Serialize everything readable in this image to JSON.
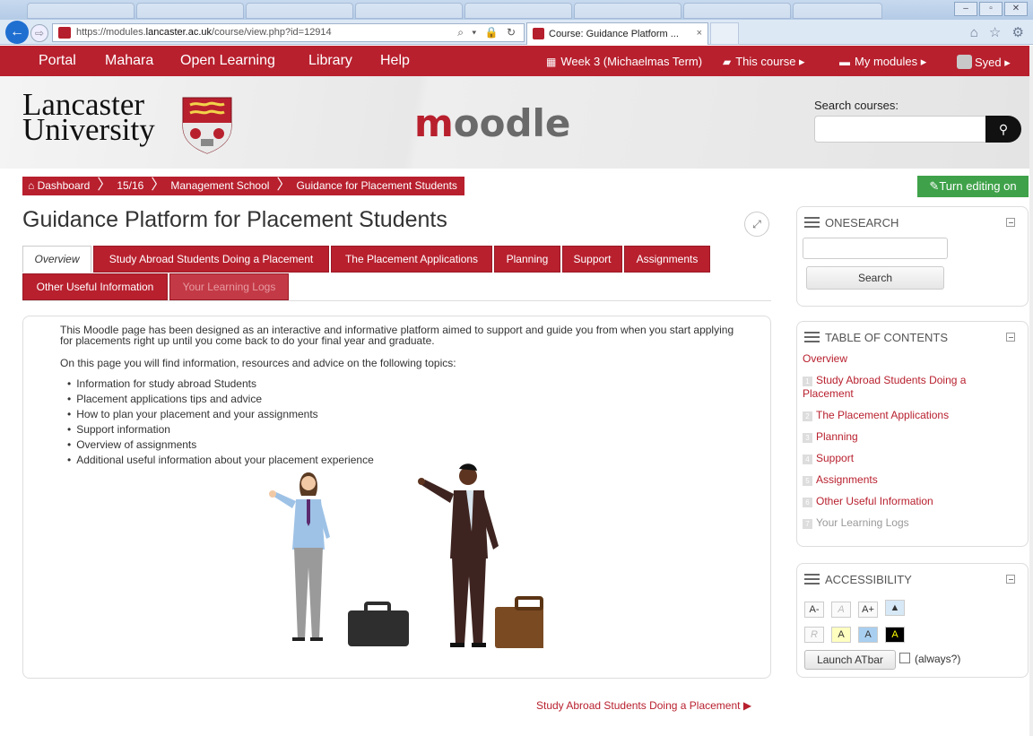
{
  "browser": {
    "url_prefix": "https://modules.",
    "url_domain": "lancaster.ac.uk",
    "url_path": "/course/view.php?id=12914",
    "url_icons": "⌕ ▾ 🔒 ↻",
    "tab_title": "Course: Guidance Platform ...",
    "tab_close": "×",
    "back": "←",
    "forward": "⇨",
    "win_min": "–",
    "win_max": "▫",
    "win_close": "✕",
    "right_icons": "⌂ ☆ ⚙"
  },
  "topnav": {
    "portal": "Portal",
    "mahara": "Mahara",
    "open_learning": "Open Learning",
    "library": "Library",
    "help": "Help",
    "week": "Week 3 (Michaelmas Term)",
    "this_course": "This course ▸",
    "my_modules": "My modules ▸",
    "user": "Syed ▸"
  },
  "header": {
    "university_line1": "Lancaster",
    "university_line2": "University",
    "moodle_m": "m",
    "moodle_rest": "oodle",
    "search_label": "Search courses:",
    "search_value": ""
  },
  "breadcrumb": [
    "Dashboard",
    "15/16",
    "Management School",
    "Guidance for Placement Students"
  ],
  "edit_button": "Turn editing on",
  "page_title": "Guidance Platform for Placement Students",
  "tabs_row1": [
    "Overview",
    "Study Abroad Students Doing a Placement",
    "The Placement Applications",
    "Planning",
    "Support",
    "Assignments"
  ],
  "tabs_row2": [
    "Other Useful Information",
    "Your Learning Logs"
  ],
  "content": {
    "intro": "This Moodle page has been designed as an interactive and informative platform aimed to support and guide you from when you start applying for placements right up until you come back to do your final year and graduate.",
    "intro2": "On this page you will find information, resources and advice on the following topics:",
    "topics": [
      "Information for study abroad Students",
      "Placement applications tips and advice",
      "How to plan your placement and your assignments",
      "Support information",
      "Overview of assignments",
      "Additional useful information about your placement experience"
    ]
  },
  "next_link": "Study Abroad Students Doing a Placement ▶",
  "onesearch": {
    "title": "ONESEARCH",
    "button": "Search",
    "value": ""
  },
  "toc": {
    "title": "TABLE OF CONTENTS",
    "overview": "Overview",
    "items": [
      {
        "num": "1",
        "label": "Study Abroad Students Doing a Placement"
      },
      {
        "num": "2",
        "label": "The Placement Applications"
      },
      {
        "num": "3",
        "label": "Planning"
      },
      {
        "num": "4",
        "label": "Support"
      },
      {
        "num": "5",
        "label": "Assignments"
      },
      {
        "num": "6",
        "label": "Other Useful Information"
      },
      {
        "num": "7",
        "label": "Your Learning Logs"
      }
    ]
  },
  "accessibility": {
    "title": "ACCESSIBILITY",
    "dec": "A-",
    "reset": "A",
    "inc": "A+",
    "r": "R",
    "a1": "A",
    "a2": "A",
    "a3": "A",
    "launch": "Launch ATbar",
    "always": "(always?)"
  },
  "colors": {
    "brand_red": "#b8202e",
    "edit_green": "#3fa24a"
  }
}
